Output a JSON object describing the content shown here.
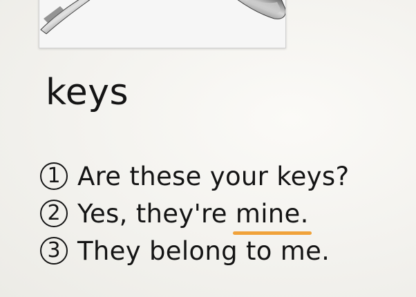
{
  "photo": {
    "icon": "keys-photo-icon"
  },
  "title": "keys",
  "sentences": [
    {
      "number": "1",
      "text": "Are these your keys?"
    },
    {
      "number": "2",
      "text_before": "Yes, they're ",
      "highlight": "mine.",
      "highlight_color": "#f0a23a"
    },
    {
      "number": "3",
      "text": "They belong to me."
    }
  ]
}
